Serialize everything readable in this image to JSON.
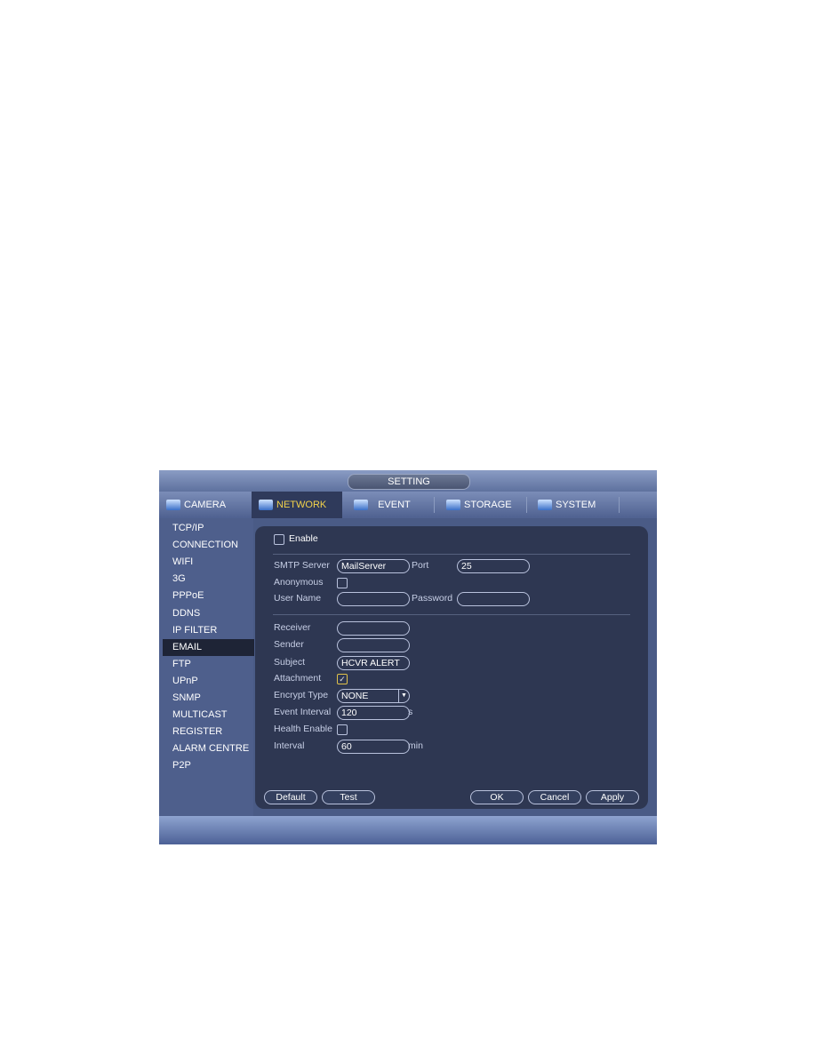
{
  "title": "SETTING",
  "tabs": [
    {
      "label": "CAMERA"
    },
    {
      "label": "NETWORK",
      "active": true
    },
    {
      "label": "EVENT"
    },
    {
      "label": "STORAGE"
    },
    {
      "label": "SYSTEM"
    }
  ],
  "sidebar": [
    "TCP/IP",
    "CONNECTION",
    "WIFI",
    "3G",
    "PPPoE",
    "DDNS",
    "IP FILTER",
    "EMAIL",
    "FTP",
    "UPnP",
    "SNMP",
    "MULTICAST",
    "REGISTER",
    "ALARM CENTRE",
    "P2P"
  ],
  "form": {
    "enable": {
      "label": "Enable",
      "checked": false
    },
    "smtp_server": {
      "label": "SMTP Server",
      "value": "MailServer"
    },
    "port": {
      "label": "Port",
      "value": "25"
    },
    "anonymous": {
      "label": "Anonymous",
      "checked": false
    },
    "user_name": {
      "label": "User Name",
      "value": ""
    },
    "password": {
      "label": "Password",
      "value": ""
    },
    "receiver": {
      "label": "Receiver",
      "value": ""
    },
    "sender": {
      "label": "Sender",
      "value": ""
    },
    "subject": {
      "label": "Subject",
      "value": "HCVR ALERT"
    },
    "attachment": {
      "label": "Attachment",
      "checked": true
    },
    "encrypt_type": {
      "label": "Encrypt Type",
      "value": "NONE"
    },
    "event_interval": {
      "label": "Event Interval",
      "value": "120",
      "unit": "s"
    },
    "health_enable": {
      "label": "Health Enable",
      "checked": false
    },
    "interval": {
      "label": "Interval",
      "value": "60",
      "unit": "min"
    }
  },
  "buttons": {
    "default": "Default",
    "test": "Test",
    "ok": "OK",
    "cancel": "Cancel",
    "apply": "Apply"
  },
  "colors": {
    "active_tab_text": "#f2d24a",
    "panel": "#2e3752",
    "window": "#4a5b86"
  }
}
